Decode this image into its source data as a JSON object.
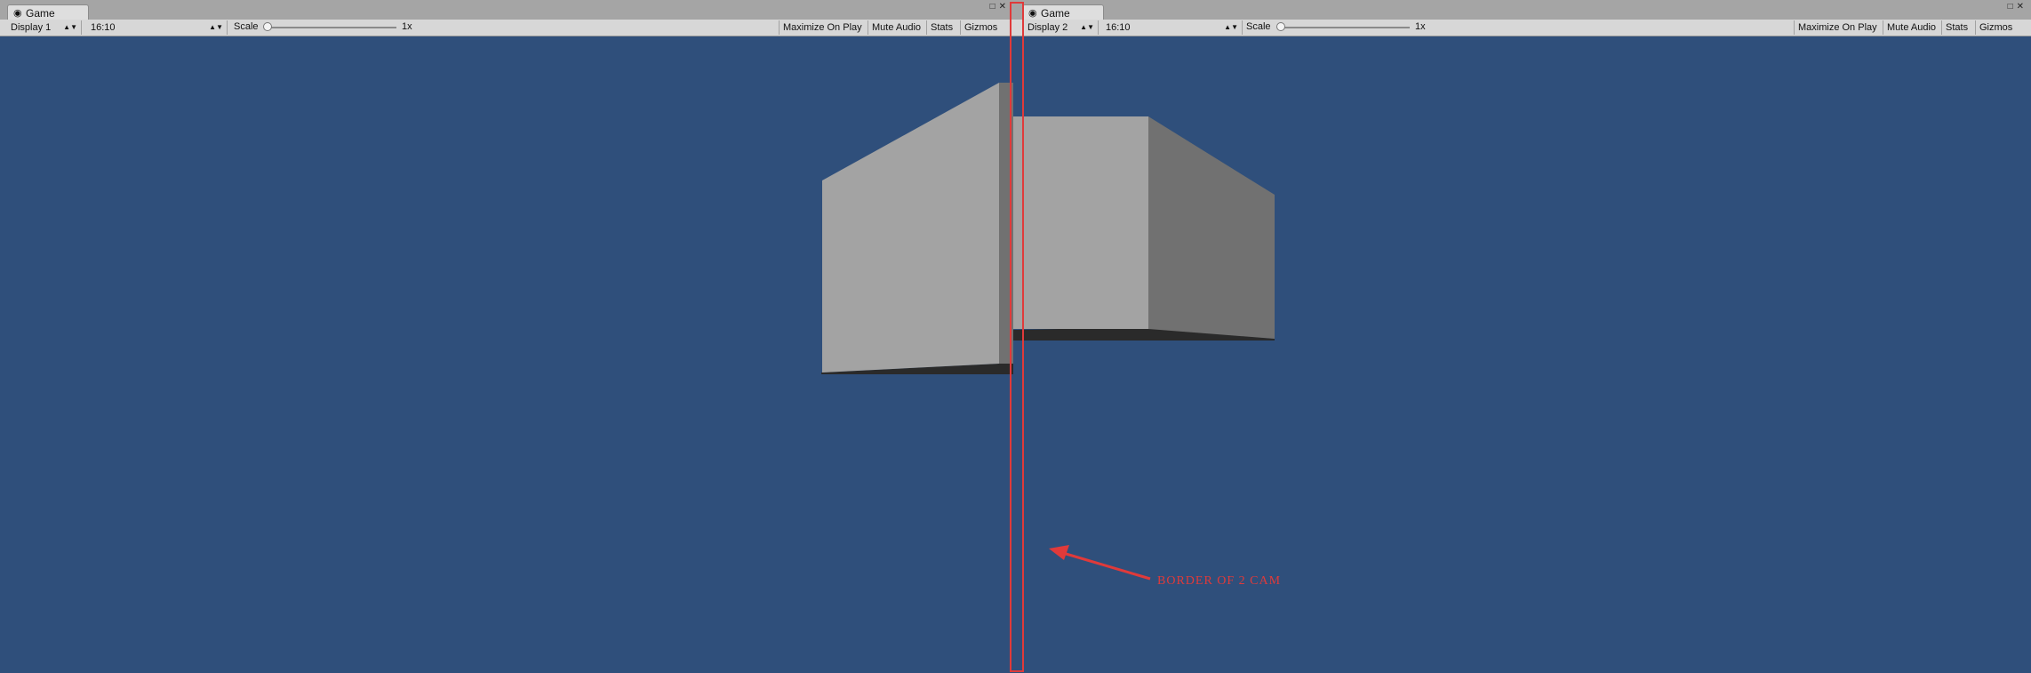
{
  "left_panel": {
    "tab_label": "Game",
    "tab_icon": "game-icon",
    "display": "Display 1",
    "aspect": "16:10",
    "scale_label": "Scale",
    "scale_value": "1x",
    "buttons": [
      "Maximize On Play",
      "Mute Audio",
      "Stats",
      "Gizmos"
    ]
  },
  "right_panel": {
    "tab_label": "Game",
    "tab_icon": "game-icon",
    "display": "Display 2",
    "aspect": "16:10",
    "scale_label": "Scale",
    "scale_value": "1x",
    "buttons": [
      "Maximize On Play",
      "Mute Audio",
      "Stats",
      "Gizmos"
    ]
  },
  "annotation": {
    "label": "BORDER OF 2 CAM",
    "color": "#e03a3a"
  },
  "colors": {
    "viewport_background": "#2f4f7b",
    "box_light": "#a3a3a3",
    "box_dark": "#717171",
    "shadow": "#2a2a2a"
  }
}
